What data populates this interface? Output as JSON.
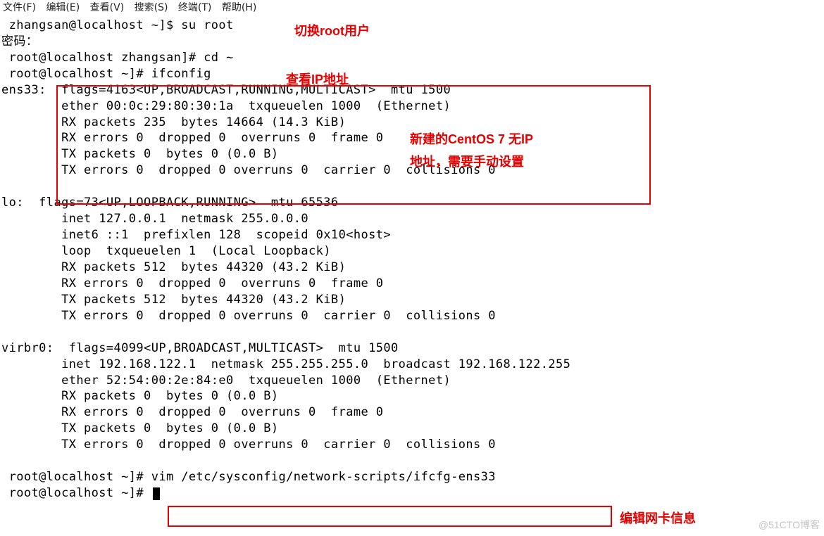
{
  "menu": {
    "file": "文件(F)",
    "edit": "编辑(E)",
    "view": "查看(V)",
    "search": "搜索(S)",
    "terminal": "终端(T)",
    "help": "帮助(H)"
  },
  "lines": {
    "l1": " zhangsan@localhost ~]$ su root",
    "l2": "密码：",
    "l3": " root@localhost zhangsan]# cd ~",
    "l4": " root@localhost ~]# ifconfig",
    "ens33_head": "ens33:  flags=4163<UP,BROADCAST,RUNNING,MULTICAST>  mtu 1500",
    "ens33_ether": "        ether 00:0c:29:80:30:1a  txqueuelen 1000  (Ethernet)",
    "ens33_rx": "        RX packets 235  bytes 14664 (14.3 KiB)",
    "ens33_rxerr": "        RX errors 0  dropped 0  overruns 0  frame 0",
    "ens33_tx": "        TX packets 0  bytes 0 (0.0 B)",
    "ens33_txerr": "        TX errors 0  dropped 0 overruns 0  carrier 0  collisions 0",
    "lo_head": "lo:  flags=73<UP,LOOPBACK,RUNNING>  mtu 65536",
    "lo_inet": "        inet 127.0.0.1  netmask 255.0.0.0",
    "lo_inet6": "        inet6 ::1  prefixlen 128  scopeid 0x10<host>",
    "lo_loop": "        loop  txqueuelen 1  (Local Loopback)",
    "lo_rx": "        RX packets 512  bytes 44320 (43.2 KiB)",
    "lo_rxerr": "        RX errors 0  dropped 0  overruns 0  frame 0",
    "lo_tx": "        TX packets 512  bytes 44320 (43.2 KiB)",
    "lo_txerr": "        TX errors 0  dropped 0 overruns 0  carrier 0  collisions 0",
    "virbr0_head": "virbr0:  flags=4099<UP,BROADCAST,MULTICAST>  mtu 1500",
    "virbr0_inet": "        inet 192.168.122.1  netmask 255.255.255.0  broadcast 192.168.122.255",
    "virbr0_ether": "        ether 52:54:00:2e:84:e0  txqueuelen 1000  (Ethernet)",
    "virbr0_rx": "        RX packets 0  bytes 0 (0.0 B)",
    "virbr0_rxerr": "        RX errors 0  dropped 0  overruns 0  frame 0",
    "virbr0_tx": "        TX packets 0  bytes 0 (0.0 B)",
    "virbr0_txerr": "        TX errors 0  dropped 0 overruns 0  carrier 0  collisions 0",
    "prompt_vim": " root@localhost ~]# vim /etc/sysconfig/network-scripts/ifcfg-ens33",
    "prompt_end": " root@localhost ~]# "
  },
  "annotations": {
    "switch_root": "切换root用户",
    "check_ip": "查看IP地址",
    "no_ip_1": "新建的CentOS 7 无IP",
    "no_ip_2": "地址，需要手动设置",
    "edit_nic": "编辑网卡信息"
  },
  "watermark": "@51CTO博客"
}
